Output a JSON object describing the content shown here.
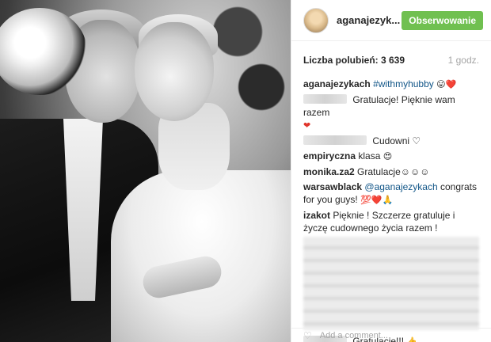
{
  "header": {
    "username": "aganajezykach",
    "username_display": "aganajezyk...",
    "follow_label": "Obserwowanie"
  },
  "stats": {
    "likes": "Liczba polubień: 3 639",
    "time": "1 godz."
  },
  "caption": {
    "user": "aganajezykach",
    "tag": "#withmyhubby",
    "emoji": "😛❤️"
  },
  "comments": [
    {
      "user": "",
      "text": "Gratulacje! Pięknie wam razem",
      "emoji": "❤"
    },
    {
      "user": "",
      "text": "Cudowni ♡"
    },
    {
      "user": "empiryczna",
      "text": "klasa",
      "emoji": "😍"
    },
    {
      "user": "monika.za2",
      "text": "Gratulacje☺☺☺"
    },
    {
      "user": "warsawblack",
      "mention": "@aganajezykach",
      "text": "congrats for you guys!",
      "emoji": "💯❤️🙏"
    },
    {
      "user": "izakot",
      "text": "Pięknie ! Szczerze gratuluje i życzę cudownego życia razem !"
    },
    {
      "user": "",
      "text": "Gratulacje!!!",
      "emoji": "👍"
    }
  ],
  "bottom": {
    "like_icon": "heart-outline-icon",
    "placeholder": "Add a comment..."
  }
}
